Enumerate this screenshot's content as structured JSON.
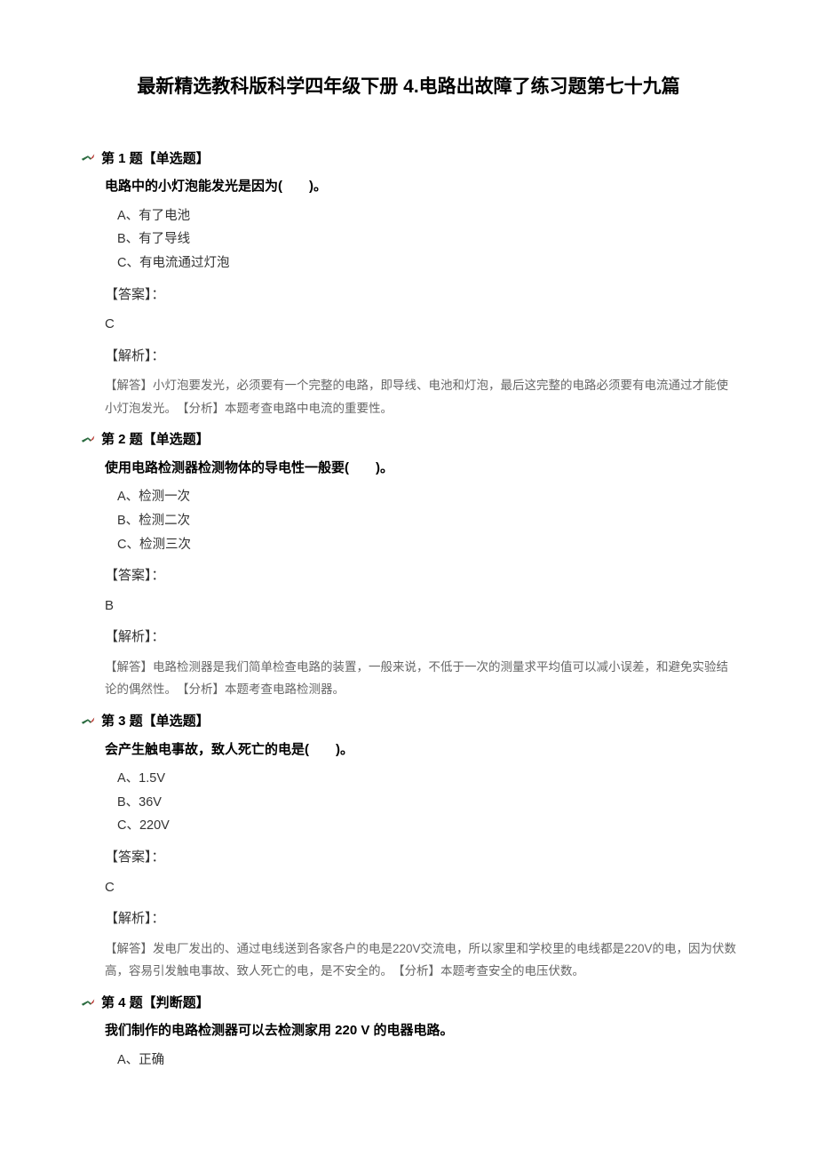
{
  "title": "最新精选教科版科学四年级下册 4.电路出故障了练习题第七十九篇",
  "questions": [
    {
      "header": "第 1 题【单选题】",
      "text": "电路中的小灯泡能发光是因为(　　)。",
      "options": [
        "A、有了电池",
        "B、有了导线",
        "C、有电流通过灯泡"
      ],
      "answer_label": "【答案】：",
      "answer": "C",
      "analysis_label": "【解析】：",
      "analysis": "【解答】小灯泡要发光，必须要有一个完整的电路，即导线、电池和灯泡，最后这完整的电路必须要有电流通过才能使小灯泡发光。　【分析】本题考查电路中电流的重要性。"
    },
    {
      "header": "第 2 题【单选题】",
      "text": "使用电路检测器检测物体的导电性一般要(　　)。",
      "options": [
        "A、检测一次",
        "B、检测二次",
        "C、检测三次"
      ],
      "answer_label": "【答案】：",
      "answer": "B",
      "analysis_label": "【解析】：",
      "analysis": "【解答】电路检测器是我们简单检查电路的装置，一般来说，不低于一次的测量求平均值可以减小误差，和避免实验结论的偶然性。　【分析】本题考查电路检测器。"
    },
    {
      "header": "第 3 题【单选题】",
      "text": "会产生触电事故，致人死亡的电是(　　)。",
      "options": [
        "A、1.5V",
        "B、36V",
        "C、220V"
      ],
      "answer_label": "【答案】：",
      "answer": "C",
      "analysis_label": "【解析】：",
      "analysis": "【解答】发电厂发出的、通过电线送到各家各户的电是220V交流电，所以家里和学校里的电线都是220V的电，因为伏数高，容易引发触电事故、致人死亡的电，是不安全的。　【分析】本题考查安全的电压伏数。"
    },
    {
      "header": "第 4 题【判断题】",
      "text": "我们制作的电路检测器可以去检测家用 220 V 的电器电路。",
      "options": [
        "A、正确"
      ],
      "answer_label": "",
      "answer": "",
      "analysis_label": "",
      "analysis": ""
    }
  ]
}
